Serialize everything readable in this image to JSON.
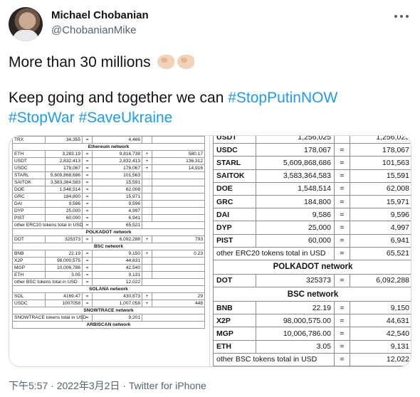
{
  "author": {
    "name": "Michael Chobanian",
    "handle": "@ChobanianMike"
  },
  "tweet": {
    "line1": "More than 30 millions",
    "line2_text": "Keep going and together we can ",
    "hashtags": [
      "#StopPutinNOW",
      "#StopWar",
      "#SaveUkraine"
    ],
    "emoji": "flexed-biceps x2"
  },
  "left_image": {
    "rows": [
      {
        "t": "row",
        "c": [
          "TRX",
          "34,355",
          "=",
          "4,466",
          "",
          ""
        ]
      },
      {
        "t": "sec",
        "label": "Ethereum network"
      },
      {
        "t": "row",
        "c": [
          "ETH",
          "3,283.19",
          "=",
          "9,816,738",
          "+",
          "580.17"
        ]
      },
      {
        "t": "row",
        "c": [
          "USDT",
          "2,832,413",
          "=",
          "2,832,413",
          "+",
          "136,312"
        ]
      },
      {
        "t": "row",
        "c": [
          "USDC",
          "178,067",
          "=",
          "178,067",
          "+",
          "14,916"
        ]
      },
      {
        "t": "row",
        "c": [
          "STARL",
          "5,609,868,686",
          "=",
          "101,563",
          "",
          ""
        ]
      },
      {
        "t": "row",
        "c": [
          "SAITOK",
          "3,583,364,583",
          "=",
          "15,591",
          "",
          ""
        ]
      },
      {
        "t": "row",
        "c": [
          "DOE",
          "1,548,514",
          "=",
          "62,008",
          "",
          ""
        ]
      },
      {
        "t": "row",
        "c": [
          "GRC",
          "184,800",
          "=",
          "15,971",
          "",
          ""
        ]
      },
      {
        "t": "row",
        "c": [
          "DAI",
          "9,586",
          "=",
          "9,596",
          "",
          ""
        ]
      },
      {
        "t": "row",
        "c": [
          "DYP",
          "25,000",
          "=",
          "4,997",
          "",
          ""
        ]
      },
      {
        "t": "row",
        "c": [
          "PIST",
          "60,000",
          "=",
          "6,941",
          "",
          ""
        ]
      },
      {
        "t": "tot",
        "label": "other ERC20 tokens total in USD",
        "op": "=",
        "val": "65,521"
      },
      {
        "t": "sec",
        "label": "POLKADOT network"
      },
      {
        "t": "row",
        "c": [
          "DOT",
          "325373",
          "=",
          "6,092,288",
          "+",
          "793"
        ]
      },
      {
        "t": "sec",
        "label": "BSC network"
      },
      {
        "t": "row",
        "c": [
          "BNB",
          "22.19",
          "=",
          "9,150",
          "+",
          "0.23"
        ]
      },
      {
        "t": "row",
        "c": [
          "X2P",
          "98,000,575",
          "=",
          "44,631",
          "",
          ""
        ]
      },
      {
        "t": "row",
        "c": [
          "MGP",
          "10,006,786",
          "=",
          "42,540",
          "",
          ""
        ]
      },
      {
        "t": "row",
        "c": [
          "ETH",
          "3.05",
          "=",
          "9,131",
          "",
          ""
        ]
      },
      {
        "t": "tot",
        "label": "other BSC tokens total in USD",
        "op": "=",
        "val": "12,022"
      },
      {
        "t": "sec",
        "label": "SOLANA network"
      },
      {
        "t": "row",
        "c": [
          "SOL",
          "4169.47",
          "=",
          "430,873",
          "+",
          "29"
        ]
      },
      {
        "t": "row",
        "c": [
          "USDC",
          "1007058",
          "=",
          "1,007,058",
          "+",
          "448"
        ]
      },
      {
        "t": "sec",
        "label": "SNOWTRACE network"
      },
      {
        "t": "tot",
        "label": "SNOWTRACE tokens total in USD",
        "op": "=",
        "val": "9,201"
      },
      {
        "t": "sec",
        "label": "ARBISCAN network"
      }
    ]
  },
  "right_image": {
    "rows": [
      {
        "t": "row",
        "c": [
          "USDT",
          "1,256,025",
          "",
          "1,256,025"
        ]
      },
      {
        "t": "row",
        "c": [
          "USDC",
          "178,067",
          "=",
          "178,067"
        ]
      },
      {
        "t": "row",
        "c": [
          "STARL",
          "5,609,868,686",
          "=",
          "101,563"
        ]
      },
      {
        "t": "row",
        "c": [
          "SAITOK",
          "3,583,364,583",
          "=",
          "15,591"
        ]
      },
      {
        "t": "row",
        "c": [
          "DOE",
          "1,548,514",
          "=",
          "62,008"
        ]
      },
      {
        "t": "row",
        "c": [
          "GRC",
          "184,800",
          "=",
          "15,971"
        ]
      },
      {
        "t": "row",
        "c": [
          "DAI",
          "9,586",
          "=",
          "9,596"
        ]
      },
      {
        "t": "row",
        "c": [
          "DYP",
          "25,000",
          "=",
          "4,997"
        ]
      },
      {
        "t": "row",
        "c": [
          "PIST",
          "60,000",
          "=",
          "6,941"
        ]
      },
      {
        "t": "tot",
        "label": "other ERC20 tokens total in USD",
        "op": "=",
        "val": "65,521"
      },
      {
        "t": "sec",
        "label": "POLKADOT network"
      },
      {
        "t": "row",
        "c": [
          "DOT",
          "325373",
          "=",
          "6,092,288"
        ]
      },
      {
        "t": "sec",
        "label": "BSC network"
      },
      {
        "t": "row",
        "c": [
          "BNB",
          "22.19",
          "=",
          "9,150"
        ]
      },
      {
        "t": "row",
        "c": [
          "X2P",
          "98,000,575.00",
          "=",
          "44,631"
        ]
      },
      {
        "t": "row",
        "c": [
          "MGP",
          "10,006,786.00",
          "=",
          "42,540"
        ]
      },
      {
        "t": "row",
        "c": [
          "ETH",
          "3.05",
          "=",
          "9,131"
        ]
      },
      {
        "t": "tot",
        "label": "other BSC tokens total in USD",
        "op": "=",
        "val": "12,022"
      },
      {
        "t": "sec",
        "label": "SOLANA network"
      },
      {
        "t": "row",
        "c": [
          "SOL",
          "4169.47",
          "=",
          "430,873"
        ]
      }
    ]
  },
  "meta": {
    "time": "下午5:57",
    "separator": "·",
    "date": "2022年3月2日",
    "source": "Twitter for iPhone"
  }
}
